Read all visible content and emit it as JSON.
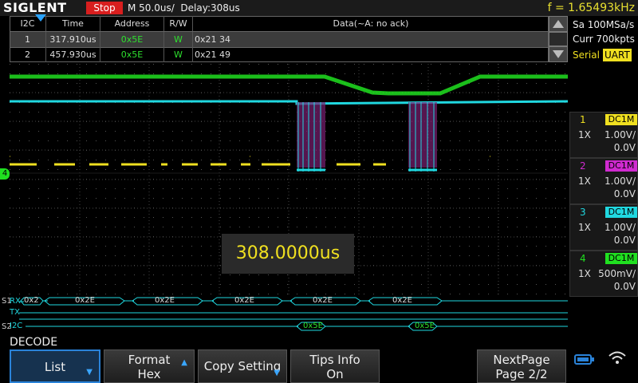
{
  "topbar": {
    "logo": "SIGLENT",
    "status": "Stop",
    "timebase": "M 50.0us/  Delay:308us",
    "frequency": "f = 1.65493kHz"
  },
  "decode_table": {
    "headers": [
      "I2C",
      "Time",
      "Address",
      "R/W",
      "Data(~A: no ack)"
    ],
    "rows": [
      {
        "idx": "1",
        "time": "317.910us",
        "address": "0x5E",
        "rw": "W",
        "data": "0x21 34"
      },
      {
        "idx": "2",
        "time": "457.930us",
        "address": "0x5E",
        "rw": "W",
        "data": "0x21 49"
      }
    ]
  },
  "acquisition": {
    "sample_rate": "Sa 100MSa/s",
    "memory": "Curr 700kpts",
    "trigger_label": "Serial",
    "trigger_type": "UART"
  },
  "channels": [
    {
      "num": "1",
      "coupling": "DC1M",
      "probe": "1X",
      "scale": "1.00V/",
      "offset": "0.0V",
      "color": "#f0e020"
    },
    {
      "num": "2",
      "coupling": "DC1M",
      "probe": "1X",
      "scale": "1.00V/",
      "offset": "0.0V",
      "color": "#d02ad0"
    },
    {
      "num": "3",
      "coupling": "DC1M",
      "probe": "1X",
      "scale": "1.00V/",
      "offset": "0.0V",
      "color": "#20d8e0"
    },
    {
      "num": "4",
      "coupling": "DC1M",
      "probe": "1X",
      "scale": "500mV/",
      "offset": "0.0V",
      "color": "#20e020"
    }
  ],
  "measurement": "308.0000us",
  "bus": {
    "s1_label": "S1",
    "rx_label": "RX",
    "tx_label": "TX",
    "s2_label": "S2",
    "i2c_label": "I2C",
    "rx_first": "0x2",
    "rx_values": [
      "0x2E",
      "0x2E",
      "0x2E",
      "0x2E",
      "0x2E"
    ],
    "i2c_values": [
      "0x5E",
      "0x5E"
    ]
  },
  "ch4_marker": "4",
  "menu": {
    "title": "DECODE",
    "buttons": [
      {
        "line1": "List",
        "line2": ""
      },
      {
        "line1": "Format",
        "line2": "Hex"
      },
      {
        "line1": "Copy Setting",
        "line2": ""
      },
      {
        "line1": "Tips Info",
        "line2": "On"
      },
      {
        "line1": "NextPage",
        "line2": "Page 2/2"
      }
    ]
  }
}
